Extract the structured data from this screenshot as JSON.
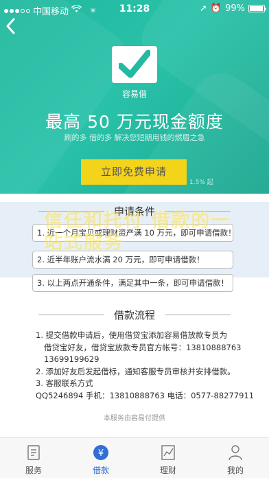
{
  "status_bar": {
    "carrier": "中国移动",
    "time": "11:28",
    "battery": "99%"
  },
  "hero": {
    "brand": "容易借",
    "headline": "最高 50 万元现金额度",
    "subline": "刷的多 借的多 解决您短期用钱的燃眉之急",
    "apply_button": "立即免费申请",
    "rate_note": "1.5% 起",
    "accent_color": "#22bba2",
    "button_color": "#f4d31b"
  },
  "conditions": {
    "title": "申请条件",
    "items": [
      "1. 近一个月宝贝或理财资产满 10 万元，即可申请借款！",
      "2. 近半年账户流水满 20 万元，即可申请借款！",
      "3. 以上两点开通条件，满足其中一条，即可申请借款！"
    ],
    "overlay": "信任和托付 借款的一站式服务"
  },
  "process": {
    "title": "借款流程",
    "lines": [
      "1. 提交借款申请后，使用借贷宝添加容易借放款专员为",
      "借贷宝好友，借贷宝放款专员官方帐号：13810888763",
      "13699199629",
      "2. 添加好友后发起借标，通知客服专员审核并安排借款。",
      "3. 客服联系方式",
      "QQ5246894 手机：13810888763 电话：0577-88277911"
    ],
    "footer": "本服务由容易付提供"
  },
  "tabbar": {
    "tabs": [
      {
        "label": "服务",
        "icon": "document-icon"
      },
      {
        "label": "借款",
        "icon": "yen-icon"
      },
      {
        "label": "理财",
        "icon": "chart-icon"
      },
      {
        "label": "我的",
        "icon": "person-icon"
      }
    ],
    "active_color": "#2f6fd6"
  }
}
